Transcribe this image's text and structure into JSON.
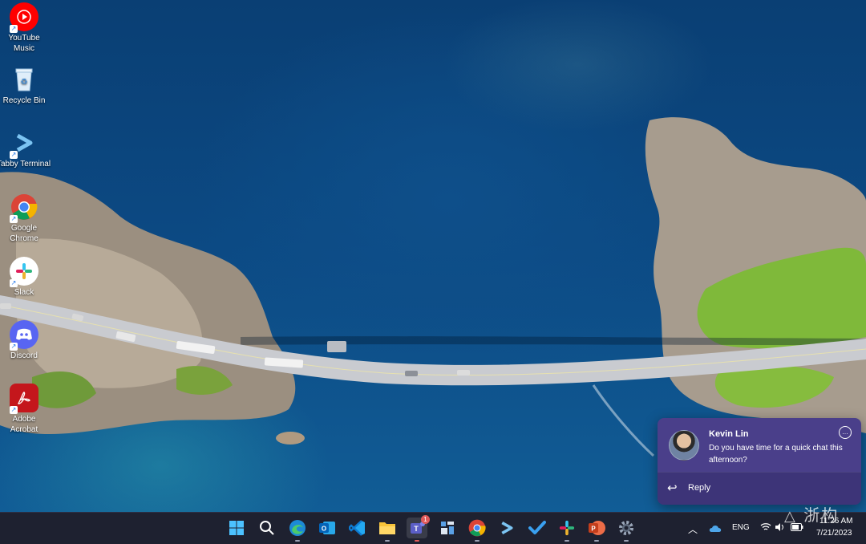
{
  "desktop": {
    "icons": [
      {
        "label": "YouTube Music",
        "icon": "youtube-music-icon",
        "color": "#ff0000"
      },
      {
        "label": "Recycle Bin",
        "icon": "recycle-bin-icon",
        "color": "#cfe3f3"
      },
      {
        "label": "Tabby Terminal",
        "icon": "tabby-terminal-icon",
        "color": "#6fb6e8"
      },
      {
        "label": "Google Chrome",
        "icon": "chrome-icon",
        "color": "#4285f4"
      },
      {
        "label": "Slack",
        "icon": "slack-icon",
        "color": "#ffffff"
      },
      {
        "label": "Discord",
        "icon": "discord-icon",
        "color": "#5865f2"
      },
      {
        "label": "Adobe Acrobat",
        "icon": "acrobat-icon",
        "color": "#c4161c"
      }
    ]
  },
  "notification": {
    "sender": "Kevin Lin",
    "message": "Do you have time for a quick chat this afternoon?",
    "reply_label": "Reply",
    "accent": "#4a3f8a"
  },
  "taskbar": {
    "apps": [
      {
        "name": "start",
        "icon": "windows-start-icon"
      },
      {
        "name": "search",
        "icon": "search-icon"
      },
      {
        "name": "edge",
        "icon": "edge-icon"
      },
      {
        "name": "outlook",
        "icon": "outlook-icon"
      },
      {
        "name": "vscode",
        "icon": "vscode-icon"
      },
      {
        "name": "file-explorer",
        "icon": "folder-icon"
      },
      {
        "name": "teams",
        "icon": "teams-icon",
        "badge": "1"
      },
      {
        "name": "app",
        "icon": "app-icon"
      },
      {
        "name": "chrome",
        "icon": "chrome-icon"
      },
      {
        "name": "tabby",
        "icon": "tabby-terminal-icon"
      },
      {
        "name": "todo",
        "icon": "todo-check-icon"
      },
      {
        "name": "slack",
        "icon": "slack-icon"
      },
      {
        "name": "powerpoint",
        "icon": "powerpoint-icon"
      },
      {
        "name": "settings",
        "icon": "gear-icon"
      }
    ],
    "tray": {
      "language": "ENG",
      "time": "11:26 AM",
      "date": "7/21/2023"
    }
  },
  "watermark": "浙构"
}
